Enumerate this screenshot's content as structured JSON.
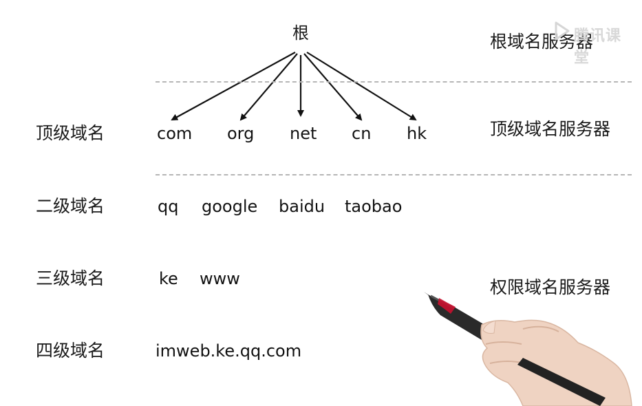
{
  "root_label": "根",
  "server_labels": {
    "root": "根域名服务器",
    "top": "顶级域名服务器",
    "authoritative": "权限域名服务器"
  },
  "levels": {
    "top": "顶级域名",
    "second": "二级域名",
    "third": "三级域名",
    "fourth": "四级域名"
  },
  "tlds": [
    "com",
    "org",
    "net",
    "cn",
    "hk"
  ],
  "second_level": [
    "qq",
    "google",
    "baidu",
    "taobao"
  ],
  "third_level": [
    "ke",
    "www"
  ],
  "fourth_level": [
    "imweb.ke.qq.com"
  ],
  "watermark": "腾讯课堂",
  "colors": {
    "line": "#111111",
    "dash": "#b5b5b5",
    "pen_band": "#c8102e"
  },
  "icons": {
    "hand": "hand-holding-pen",
    "watermark": "play-icon"
  }
}
